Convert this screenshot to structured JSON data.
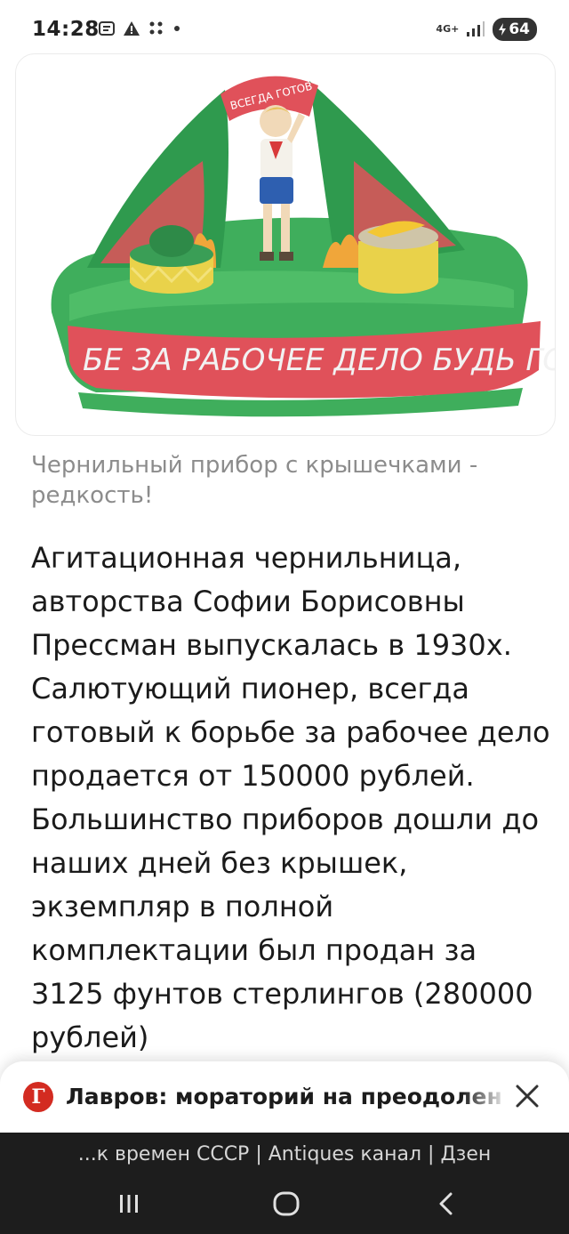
{
  "status_bar": {
    "time": "14:28",
    "network": "4G+",
    "battery": "64",
    "icons": [
      "screenshot-icon",
      "alert-icon",
      "dots-grid-icon",
      "dot-icon",
      "signal-icon",
      "battery-icon"
    ]
  },
  "article": {
    "image_alt": "Агитационная чернильница с пионером",
    "image_banner_text": "БЕ ЗА РАБОЧЕЕ ДЕЛО БУДЬ ГО",
    "image_flag_text": "ВСЕГДА ГОТОВ",
    "caption": "Чернильный прибор с крышечками - редкость!",
    "body": "Агитационная чернильница, авторства Софии Борисовны Прессман выпускалась в 1930х. Салютующий пионер, всегда готовый к борьбе за рабочее дело продается от 150000 рублей. Большинство приборов дошли до наших дней без крышек, экземпляр в полной комплектации был продан за 3125 фунтов стерлингов (280000 рублей)"
  },
  "news_bar": {
    "logo_letter": "Г",
    "text": "Лавров: мораторий на преодолен",
    "close_icon": "close-icon"
  },
  "bottom": {
    "page_title": "...к времен СССР | Antiques канал | Дзен"
  },
  "nav": {
    "recents": "recents-icon",
    "home": "home-icon",
    "back": "back-icon"
  },
  "colors": {
    "ceramic_green": "#3fae5c",
    "ceramic_red": "#e0515a",
    "ceramic_yellow": "#e9d24a",
    "news_logo": "#d32b21",
    "bottom_bg": "#1d1d1d"
  }
}
